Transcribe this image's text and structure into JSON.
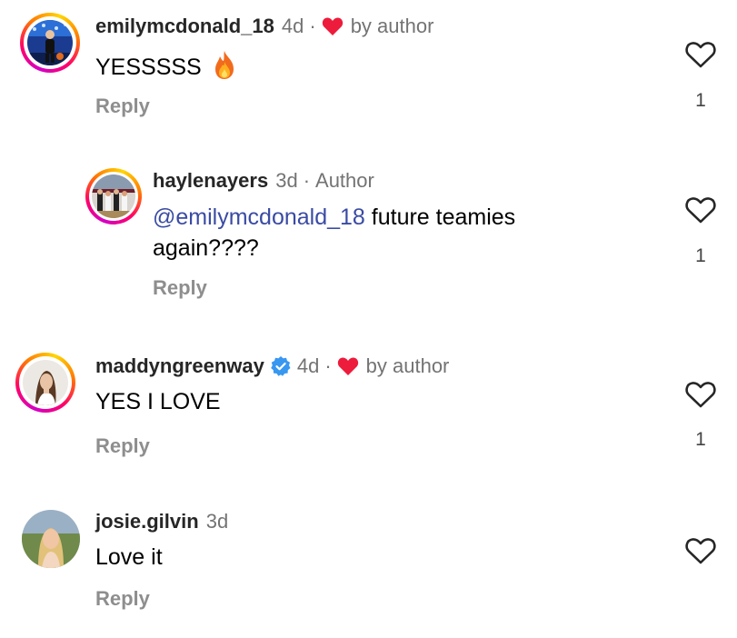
{
  "comments": [
    {
      "username": "emilymcdonald_18",
      "time": "4d",
      "dot": "·",
      "liked_label": "by author",
      "text": "YESSSSS",
      "reply_label": "Reply",
      "like_count": "1"
    },
    {
      "username": "haylenayers",
      "time": "3d",
      "dot": "·",
      "author_label": "Author",
      "mention": "@emilymcdonald_18",
      "text": " future teamies again????",
      "reply_label": "Reply",
      "like_count": "1"
    },
    {
      "username": "maddyngreenway",
      "time": "4d",
      "dot": "·",
      "liked_label": "by author",
      "text": "YES I LOVE",
      "reply_label": "Reply",
      "like_count": "1"
    },
    {
      "username": "josie.gilvin",
      "time": "3d",
      "text": "Love it",
      "reply_label": "Reply"
    }
  ],
  "icons": {
    "like": "heart-outline-icon",
    "liked_by_author": "red-heart-icon",
    "verified": "verified-badge-icon",
    "fire": "fire-emoji-icon"
  },
  "colors": {
    "mention": "#3a4ba3",
    "heart_red": "#ed1c3c",
    "verified_blue": "#3897f0",
    "secondary_text": "#737373"
  }
}
